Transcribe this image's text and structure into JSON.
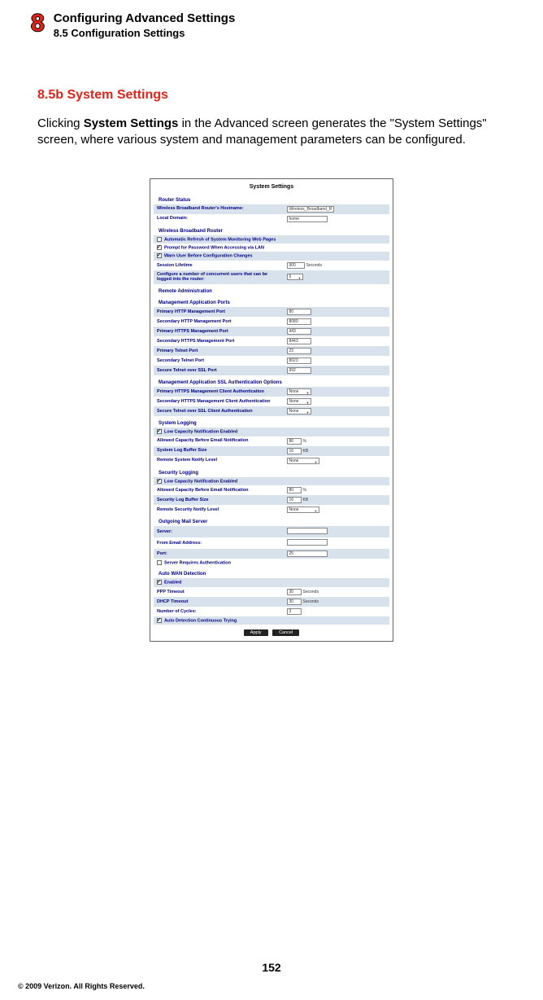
{
  "chapter_number": "8",
  "chapter_title": "Configuring Advanced Settings",
  "chapter_sub": "8.5  Configuration Settings",
  "section_head": "8.5b  System Settings",
  "body_pre": "Clicking ",
  "body_bold": "System Settings",
  "body_post": " in the Advanced screen generates the \"System Settings\" screen, where various system and management parameters can be configured.",
  "page_number": "152",
  "copyright": "© 2009 Verizon. All Rights Reserved.",
  "fig": {
    "title": "System Settings",
    "router_status": "Router Status",
    "hostname_lbl": "Wireless Broadband Router's Hostname:",
    "hostname_val": "Wireless_Broadband_R",
    "local_domain_lbl": "Local Domain:",
    "local_domain_val": "home",
    "wbr": "Wireless Broadband Router",
    "auto_refresh": "Automatic Refresh of System Monitoring Web Pages",
    "prompt_pw": "Prompt for Password When Accessing via LAN",
    "warn_chg": "Warn User Before Configuration Changes",
    "session_lifetime_lbl": "Session Lifetime",
    "session_lifetime_val": "900",
    "seconds": "Seconds",
    "concurrent_lbl": "Configure a number of concurrent users that can be logged into the router:",
    "concurrent_val": "5",
    "remote_admin": "Remote Administration",
    "mgmt_ports": "Management Application Ports",
    "p_http_lbl": "Primary HTTP Management Port",
    "p_http_val": "80",
    "s_http_lbl": "Secondary HTTP Management Port",
    "s_http_val": "8080",
    "p_https_lbl": "Primary HTTPS Management Port",
    "p_https_val": "443",
    "s_https_lbl": "Secondary HTTPS Management Port",
    "s_https_val": "8443",
    "p_telnet_lbl": "Primary Telnet Port",
    "p_telnet_val": "23",
    "s_telnet_lbl": "Secondary Telnet Port",
    "s_telnet_val": "8023",
    "ssl_telnet_lbl": "Secure Telnet over SSL Port",
    "ssl_telnet_val": "992",
    "ssl_auth": "Management Application SSL Authentication Options",
    "p_https_auth_lbl": "Primary HTTPS Management Client Authentication",
    "none": "None",
    "s_https_auth_lbl": "Secondary HTTPS Management Client Authentication",
    "sec_telnet_auth_lbl": "Secure Telnet over SSL Client Authentication",
    "sys_logging": "System Logging",
    "low_cap": "Low Capacity Notification Enabled",
    "allowed_cap_lbl": "Allowed Capacity Before Email Notification",
    "allowed_cap_val": "80",
    "pct": "%",
    "buf_lbl": "System Log Buffer Size",
    "buf_val": "16",
    "kb": "KB",
    "remote_notify_lbl": "Remote System Notify Level",
    "notify_none": "None",
    "sec_logging": "Security Logging",
    "sec_allowed_cap_lbl": "Allowed Capacity Before Email Notification",
    "sec_buf_lbl": "Security Log Buffer Size",
    "sec_remote_notify_lbl": "Remote Security Notify Level",
    "mail": "Outgoing Mail Server",
    "server_lbl": "Server:",
    "from_lbl": "From Email Address:",
    "port_lbl": "Port:",
    "port_val": "25",
    "srv_auth": "Server Requires Authentication",
    "auto_wan": "Auto WAN Detection",
    "enabled": "Enabled",
    "ppp_to_lbl": "PPP Timeout",
    "ppp_to_val": "30",
    "dhcp_to_lbl": "DHCP Timeout",
    "dhcp_to_val": "30",
    "cycles_lbl": "Number of Cycles:",
    "cycles_val": "3",
    "cont_try": "Auto Detection Continuous Trying",
    "apply": "Apply",
    "cancel": "Cancel"
  }
}
